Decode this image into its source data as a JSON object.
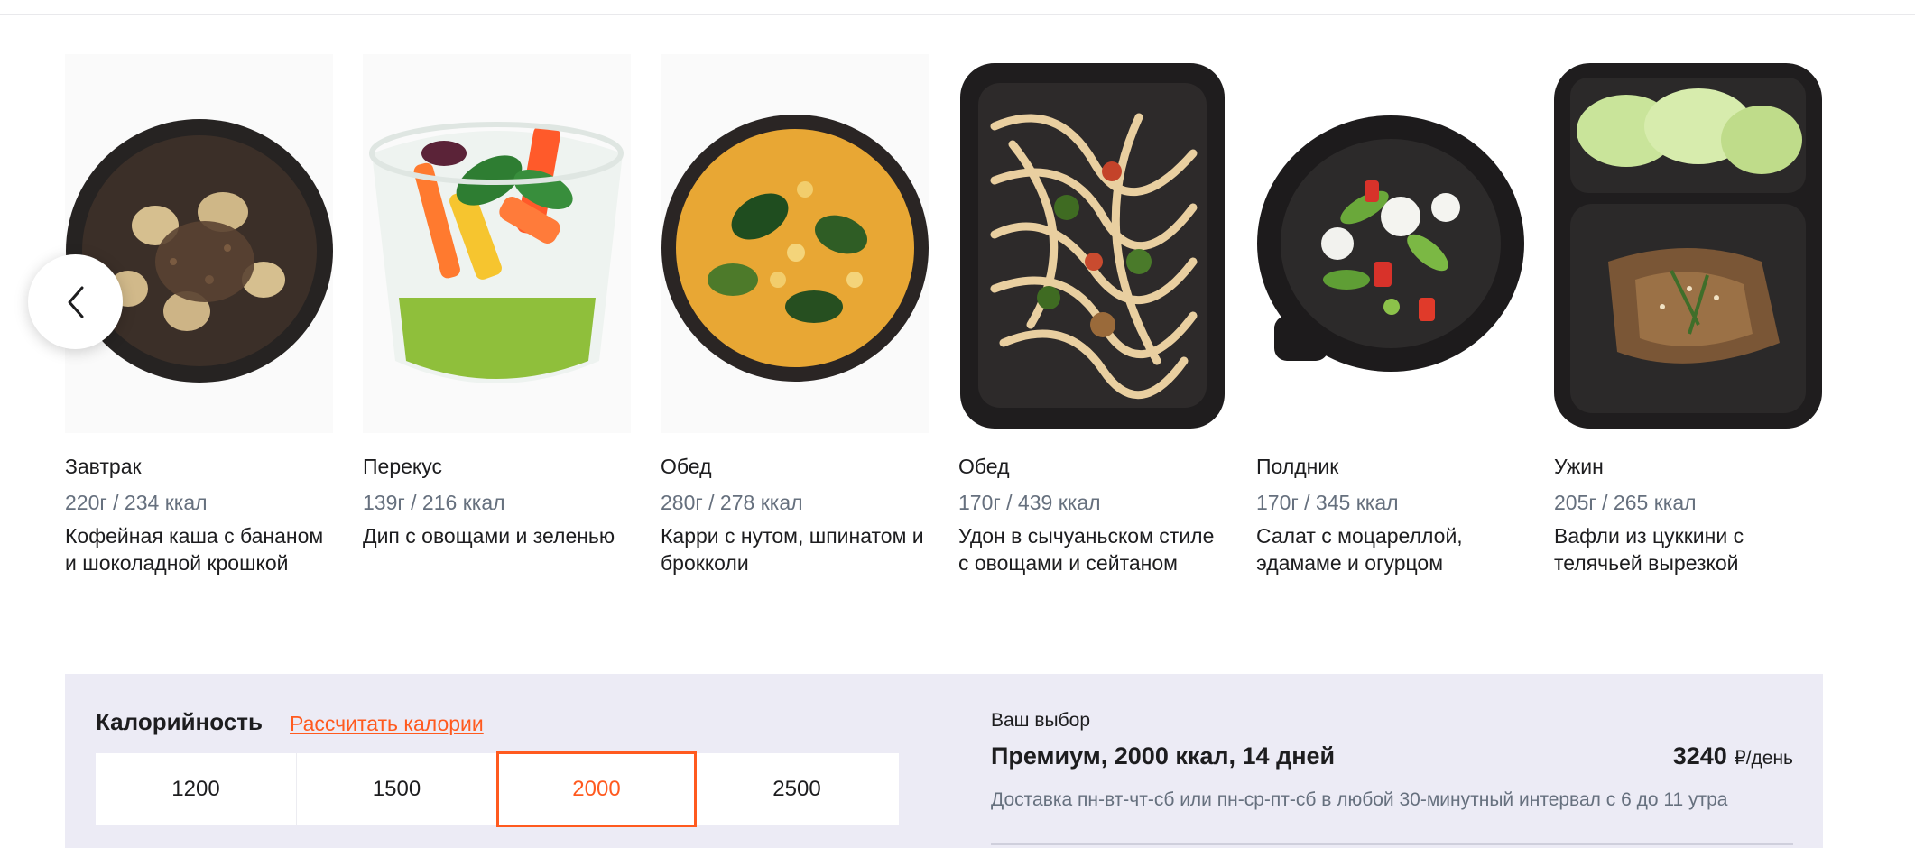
{
  "carousel": {
    "prev_icon": "chevron-left-icon",
    "items": [
      {
        "meal": "Завтрак",
        "weight": "220г / 234 ккал",
        "dish": "Кофейная каша с бананом и шоколадной крошкой"
      },
      {
        "meal": "Перекус",
        "weight": "139г / 216 ккал",
        "dish": "Дип с овощами и зеленью"
      },
      {
        "meal": "Обед",
        "weight": "280г / 278 ккал",
        "dish": "Карри с нутом, шпинатом и брокколи"
      },
      {
        "meal": "Обед",
        "weight": "170г / 439 ккал",
        "dish": "Удон в сычуаньском стиле с овощами и сейтаном"
      },
      {
        "meal": "Полдник",
        "weight": "170г / 345 ккал",
        "dish": "Салат с моцареллой, эдамаме и огурцом"
      },
      {
        "meal": "Ужин",
        "weight": "205г / 265 ккал",
        "dish": "Вафли из цуккини с телячьей вырезкой"
      }
    ]
  },
  "calories": {
    "title": "Калорийность",
    "calc_link": "Рассчитать калории",
    "options": [
      "1200",
      "1500",
      "2000",
      "2500"
    ],
    "selected": "2000"
  },
  "summary": {
    "label": "Ваш выбор",
    "title": "Премиум, 2000 ккал, 14 дней",
    "price_value": "3240",
    "price_unit": "₽/день",
    "delivery": "Доставка пн-вт-чт-сб или пн-ср-пт-сб в любой 30-минутный интервал с 6 до 11 утра"
  },
  "colors": {
    "accent": "#ff5a1f",
    "panel_bg": "#ecebf5",
    "muted_text": "#66707e"
  }
}
